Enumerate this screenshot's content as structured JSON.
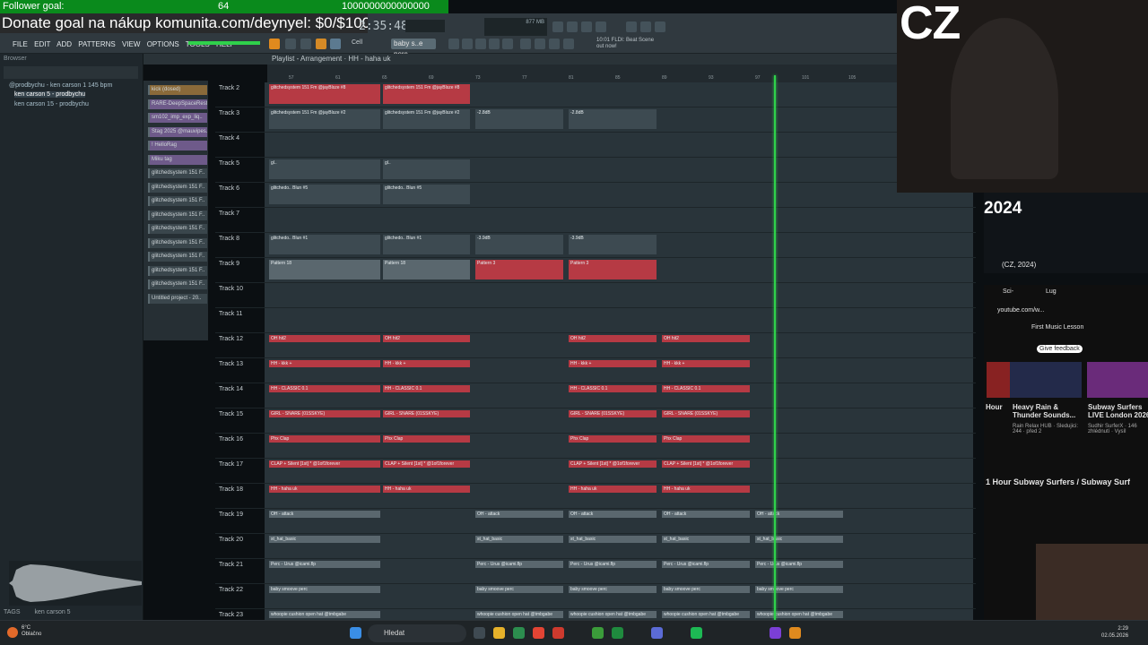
{
  "overlay": {
    "follower_label": "Follower goal:",
    "follower_count": "64",
    "follower_target": "1000000000000000",
    "donate_text": "Donate goal na nákup komunita.com/deynyel: $0/$100"
  },
  "fl": {
    "menu": [
      "FILE",
      "EDIT",
      "ADD",
      "PATTERNS",
      "VIEW",
      "OPTIONS",
      "TOOLS",
      "HELP"
    ],
    "clock": "2:35:48",
    "pattern_field": "baby s..e perc",
    "mode_label": "Cell",
    "news_text": "10:01 FLDI: Beat Scene out now!",
    "cpu_label": "877 MB",
    "playlist_title": "Playlist - Arrangement · HH - haha uk",
    "browser_header": "Browser",
    "browser_items": [
      "@prodbychu - ken carson 1 145 bpm",
      "ken carson 5 - prodbychu",
      "ken carson 15 - prodbychu"
    ],
    "tags_label": "TAGS",
    "tags_value": "ken carson 5",
    "ruler_ticks": [
      "57",
      "61",
      "65",
      "69",
      "73",
      "77",
      "81",
      "85",
      "89",
      "93",
      "97",
      "101",
      "105"
    ],
    "channels": [
      "kick (dosed)",
      "RARE-DeepSpaceRest..",
      "sm102_imp_exp_liq..",
      "Stag 2025 @mauvipes..",
      "! HelloRag",
      "Miku tag",
      "glitchedsystem 151 F..",
      "glitchedsystem 151 F..",
      "glitchedsystem 151 F..",
      "glitchedsystem 151 F..",
      "glitchedsystem 151 F..",
      "glitchedsystem 151 F..",
      "glitchedsystem 151 F..",
      "glitchedsystem 151 F..",
      "glitchedsystem 151 F..",
      "Untitled project - 20.."
    ],
    "tracks": [
      {
        "name": "Track 2",
        "clips": [
          {
            "label": "glitchedsystem 151 Fm @jayBlsze #8",
            "kind": "red"
          }
        ]
      },
      {
        "name": "Track 3",
        "clips": [
          {
            "label": "glitchedsystem 151 Fm @jayBlsze #2",
            "kind": "dk"
          },
          {
            "label": "-2.8dB",
            "kind": "dk"
          }
        ]
      },
      {
        "name": "Track 4",
        "clips": []
      },
      {
        "name": "Track 5",
        "clips": [
          {
            "label": "gl..",
            "kind": "dk"
          }
        ]
      },
      {
        "name": "Track 6",
        "clips": [
          {
            "label": "glitchedo.. Blun #5",
            "kind": "dk"
          }
        ]
      },
      {
        "name": "Track 7",
        "clips": []
      },
      {
        "name": "Track 8",
        "clips": [
          {
            "label": "glitchedo.. Blun #1",
            "kind": "dk"
          },
          {
            "label": "-3.9dB",
            "kind": "dk"
          }
        ]
      },
      {
        "name": "Track 9",
        "clips": [
          {
            "label": "Pattern 18",
            "kind": "gray"
          },
          {
            "label": "Pattern 3",
            "kind": "red"
          }
        ]
      },
      {
        "name": "Track 10",
        "clips": []
      },
      {
        "name": "Track 11",
        "clips": []
      },
      {
        "name": "Track 12",
        "clips": [
          {
            "label": "OH hit2",
            "kind": "red"
          }
        ]
      },
      {
        "name": "Track 13",
        "clips": [
          {
            "label": "HH - kkk +",
            "kind": "red"
          }
        ]
      },
      {
        "name": "Track 14",
        "clips": [
          {
            "label": "HH - CLASSIC 0.1",
            "kind": "red"
          }
        ]
      },
      {
        "name": "Track 15",
        "clips": [
          {
            "label": "GIRL - SNARE (01SSKYE)",
            "kind": "red"
          }
        ]
      },
      {
        "name": "Track 16",
        "clips": [
          {
            "label": "Phx Clap",
            "kind": "red"
          }
        ]
      },
      {
        "name": "Track 17",
        "clips": [
          {
            "label": "CLAP + Silent [1st] * @1of1forever",
            "kind": "red"
          }
        ]
      },
      {
        "name": "Track 18",
        "clips": [
          {
            "label": "HH - haha uk",
            "kind": "red"
          }
        ]
      },
      {
        "name": "Track 19",
        "clips": [
          {
            "label": "OH - attack",
            "kind": "gray"
          }
        ]
      },
      {
        "name": "Track 20",
        "clips": [
          {
            "label": "st_hat_basic",
            "kind": "gray"
          }
        ]
      },
      {
        "name": "Track 21",
        "clips": [
          {
            "label": "Perc - Urus @icami.flp",
            "kind": "gray"
          }
        ]
      },
      {
        "name": "Track 22",
        "clips": [
          {
            "label": "baby smoove perc",
            "kind": "gray"
          }
        ]
      },
      {
        "name": "Track 23",
        "clips": [
          {
            "label": "whoopie cushion open hat @tmbgabe",
            "kind": "gray"
          }
        ]
      }
    ]
  },
  "stream": {
    "cz_label": "CZ",
    "year": "2024",
    "video_title_small": "(CZ, 2024)",
    "tabs": [
      "Sci-",
      "Lug"
    ],
    "url": "youtube.com/w...",
    "bookmark": "First Music Lesson",
    "feedback": "Give feedback",
    "cards": [
      {
        "title": "Hour",
        "sub": ""
      },
      {
        "title": "Heavy Rain & Thunder Sounds...",
        "sub": "Rain Relax HUB · Sledujici: 244 · před 2"
      },
      {
        "title": "Subway Surfers LIVE London 2026",
        "sub": "Sudhir SurferX · 146 zhlédnutí · Vysíl"
      }
    ],
    "main_title": "1 Hour Subway Surfers / Subway Surf"
  },
  "taskbar": {
    "weather_temp": "6°C",
    "weather_desc": "Oblačno",
    "search": "Hledat",
    "time": "2:29",
    "date": "02.05.2026"
  }
}
